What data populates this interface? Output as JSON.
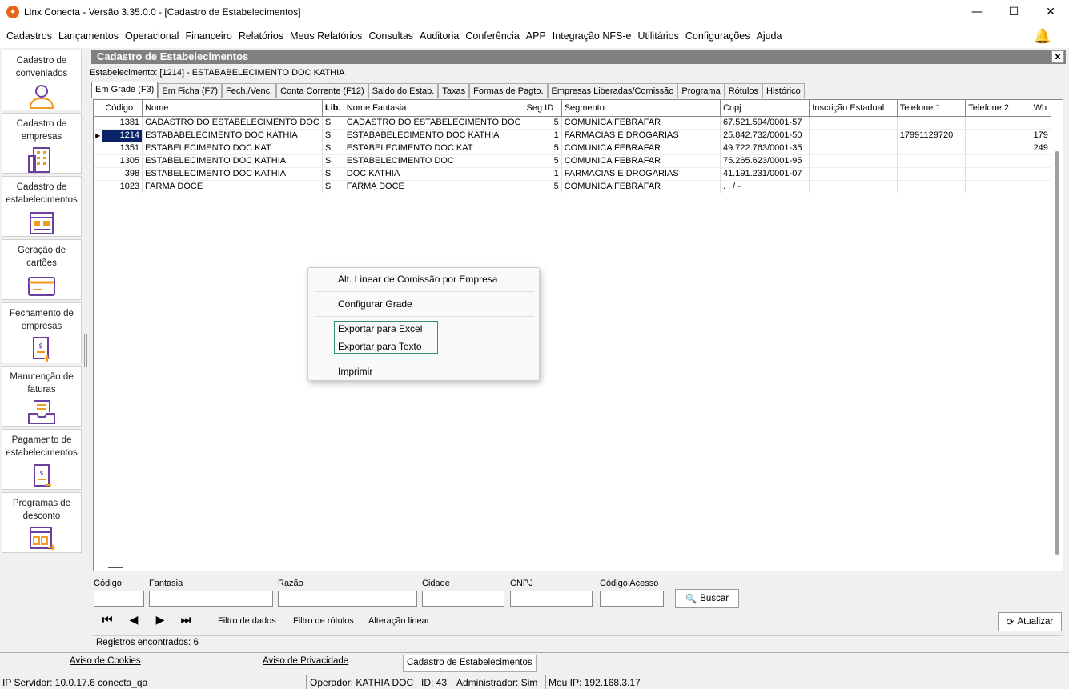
{
  "window": {
    "title": "Linx Conecta - Versão 3.35.0.0 - [Cadastro de Estabelecimentos]",
    "minimize": "—",
    "maximize": "☐",
    "close": "✕"
  },
  "menu": [
    "Cadastros",
    "Lançamentos",
    "Operacional",
    "Financeiro",
    "Relatórios",
    "Meus Relatórios",
    "Consultas",
    "Auditoria",
    "Conferência",
    "APP",
    "Integração NFS-e",
    "Utilitários",
    "Configurações",
    "Ajuda"
  ],
  "sidebar": [
    {
      "label": "Cadastro de conveniados",
      "icon": "user-icon"
    },
    {
      "label": "Cadastro de empresas",
      "icon": "building-icon"
    },
    {
      "label": "Cadastro de estabelecimentos",
      "icon": "storefront-icon"
    },
    {
      "label": "Geração de cartões",
      "icon": "card-icon"
    },
    {
      "label": "Fechamento de empresas",
      "icon": "invoice-add-icon"
    },
    {
      "label": "Manutenção de faturas",
      "icon": "inbox-tray-icon"
    },
    {
      "label": "Pagamento de estabelecimentos",
      "icon": "payment-doc-icon"
    },
    {
      "label": "Programas de desconto",
      "icon": "discount-program-icon"
    }
  ],
  "panel": {
    "title": "Cadastro de Estabelecimentos",
    "close": "x",
    "estabelecimento_line": "Estabelecimento: [1214] - ESTABABELECIMENTO DOC KATHIA"
  },
  "tabs": [
    "Em Grade (F3)",
    "Em Ficha (F7)",
    "Fech./Venc.",
    "Conta Corrente (F12)",
    "Saldo do Estab.",
    "Taxas",
    "Formas de Pagto.",
    "Empresas Liberadas/Comissão",
    "Programa",
    "Rótulos",
    "Histórico"
  ],
  "grid": {
    "columns": [
      "Código",
      "Nome",
      "Lib.",
      "Nome Fantasia",
      "Seg ID",
      "Segmento",
      "Cnpj",
      "Inscrição Estadual",
      "Telefone 1",
      "Telefone 2",
      "Wh"
    ],
    "rows": [
      [
        "1381",
        "CADASTRO DO ESTABELECIMENTO DOC",
        "S",
        "CADASTRO DO ESTABELECIMENTO DOC",
        "5",
        "COMUNICA FEBRAFAR",
        "67.521.594/0001-57",
        "",
        "",
        "",
        ""
      ],
      [
        "1214",
        "ESTABABELECIMENTO DOC KATHIA",
        "S",
        "ESTABABELECIMENTO DOC KATHIA",
        "1",
        "FARMACIAS E DROGARIAS",
        "25.842.732/0001-50",
        "",
        "17991129720",
        "",
        "179"
      ],
      [
        "1351",
        "ESTABELECIMENTO DOC KAT",
        "S",
        "ESTABELECIMENTO DOC KAT",
        "5",
        "COMUNICA FEBRAFAR",
        "49.722.763/0001-35",
        "",
        "",
        "",
        "249"
      ],
      [
        "1305",
        "ESTABELECIMENTO DOC KATHIA",
        "S",
        "ESTABELECIMENTO DOC",
        "5",
        "COMUNICA FEBRAFAR",
        "75.265.623/0001-95",
        "",
        "",
        "",
        ""
      ],
      [
        "398",
        "ESTABELECIMENTO DOC KATHIA",
        "S",
        "DOC KATHIA",
        "1",
        "FARMACIAS E DROGARIAS",
        "41.191.231/0001-07",
        "",
        "",
        "",
        ""
      ],
      [
        "1023",
        "FARMA DOCE",
        "S",
        "FARMA DOCE",
        "5",
        "COMUNICA FEBRAFAR",
        "  .   .   /    -",
        "",
        "",
        "",
        ""
      ]
    ],
    "selected_row": 1
  },
  "context_menu": [
    "Alt. Linear de Comissão por Empresa",
    "Configurar Grade",
    "Exportar para Excel",
    "Exportar para Texto",
    "Imprimir"
  ],
  "filters": {
    "codigo": "Código",
    "fantasia": "Fantasia",
    "razao": "Razão",
    "cidade": "Cidade",
    "cnpj": "CNPJ",
    "codigo_acesso": "Código Acesso",
    "buscar": "Buscar"
  },
  "nav": {
    "first": "⏮",
    "prev": "◀",
    "next": "▶",
    "last": "⏭",
    "filtro_dados": "Filtro de dados",
    "filtro_rotulos": "Filtro de rótulos",
    "alteracao_linear": "Alteração linear",
    "atualizar": "Atualizar"
  },
  "records": "Registros encontrados: 6",
  "bottom_tabs": [
    "Aviso de Cookies",
    "Aviso de Privacidade",
    "Cadastro de Estabelecimentos"
  ],
  "status": {
    "ip_servidor": "IP Servidor: 10.0.17.6 conecta_qa",
    "operador": "Operador: KATHIA DOC",
    "id": "ID: 43",
    "admin": "Administrador: Sim",
    "meu_ip": "Meu IP: 192.168.3.17"
  },
  "colors": {
    "accent_orange": "#e8641b",
    "icon_purple": "#6b3fa0",
    "icon_orange": "#f29b1d",
    "selection": "#0a246a"
  }
}
